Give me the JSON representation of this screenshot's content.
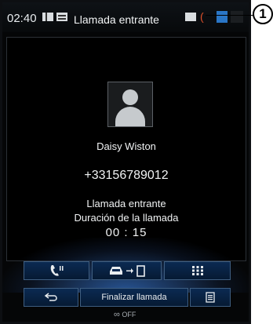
{
  "status_bar": {
    "time": "02:40",
    "title": "Llamada entrante"
  },
  "call": {
    "contact_name": "Daisy Wiston",
    "phone_number": "+33156789012",
    "status": "Llamada entrante",
    "duration_label": "Duración de la llamada",
    "duration": "00 : 15"
  },
  "actions": {
    "finish_call_label": "Finalizar llamada",
    "voice_off_label": "OFF"
  },
  "callout": {
    "number": "1"
  },
  "colors": {
    "accent_blue": "#2a76c6",
    "button_bg": "#0b2a52",
    "alert_orange": "#e0502a"
  }
}
